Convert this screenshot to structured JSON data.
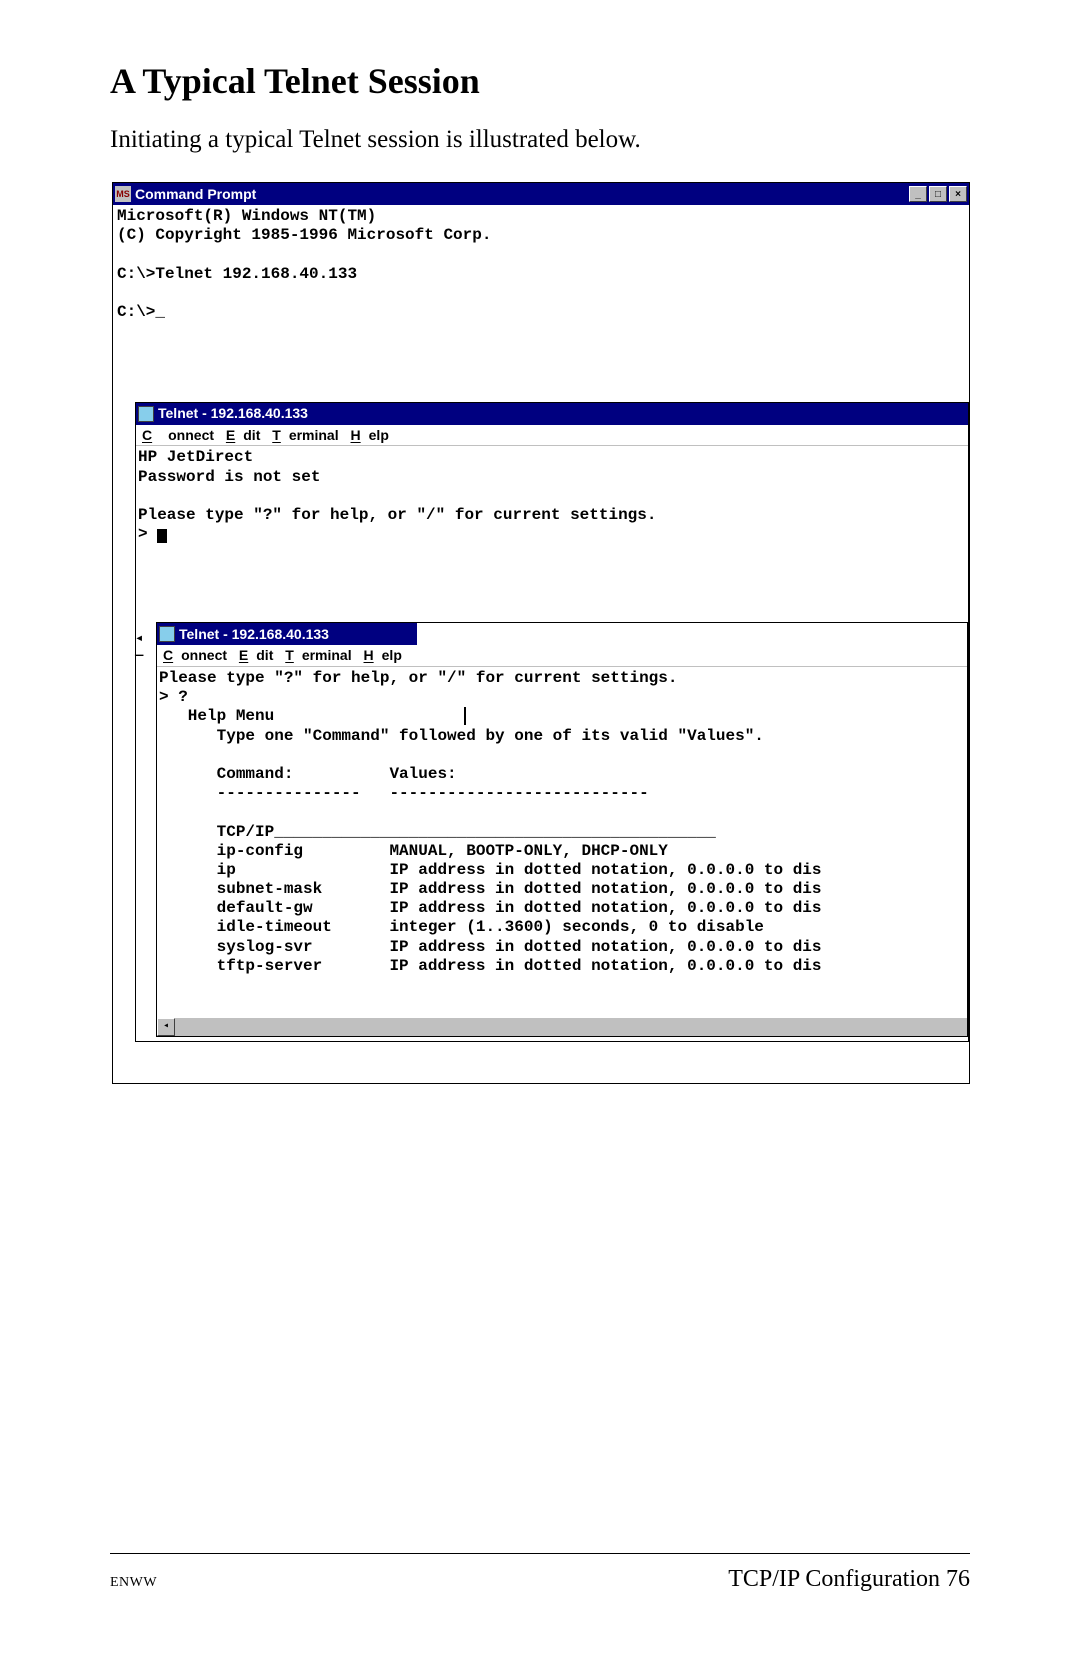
{
  "heading": "A Typical Telnet Session",
  "intro": "Initiating a typical Telnet session is illustrated below.",
  "cmdprompt": {
    "title": "Command Prompt",
    "icon_text": "MS",
    "lines": "Microsoft(R) Windows NT(TM)\n(C) Copyright 1985-1996 Microsoft Corp.\n\nC:\\>Telnet 192.168.40.133\n\nC:\\>_"
  },
  "menus": {
    "c": "Connect",
    "e": "Edit",
    "t": "Terminal",
    "h": "Help"
  },
  "telnet1": {
    "title": "Telnet - 192.168.40.133",
    "body": "HP JetDirect\nPassword is not set\n\nPlease type \"?\" for help, or \"/\" for current settings.\n> "
  },
  "telnet2": {
    "title": "Telnet - 192.168.40.133",
    "body": "Please type \"?\" for help, or \"/\" for current settings.\n> ?\n   Help Menu",
    "body2": "\n      Type one \"Command\" followed by one of its valid \"Values\".\n\n      Command:          Values:\n      ---------------   ---------------------------\n\n      TCP/IP______________________________________________\n      ip-config         MANUAL, BOOTP-ONLY, DHCP-ONLY\n      ip                IP address in dotted notation, 0.0.0.0 to dis\n      subnet-mask       IP address in dotted notation, 0.0.0.0 to dis\n      default-gw        IP address in dotted notation, 0.0.0.0 to dis\n      idle-timeout      integer (1..3600) seconds, 0 to disable\n      syslog-svr        IP address in dotted notation, 0.0.0.0 to dis\n      tftp-server       IP address in dotted notation, 0.0.0.0 to dis"
  },
  "footer": {
    "left": "ENWW",
    "right": "TCP/IP Configuration 76"
  }
}
